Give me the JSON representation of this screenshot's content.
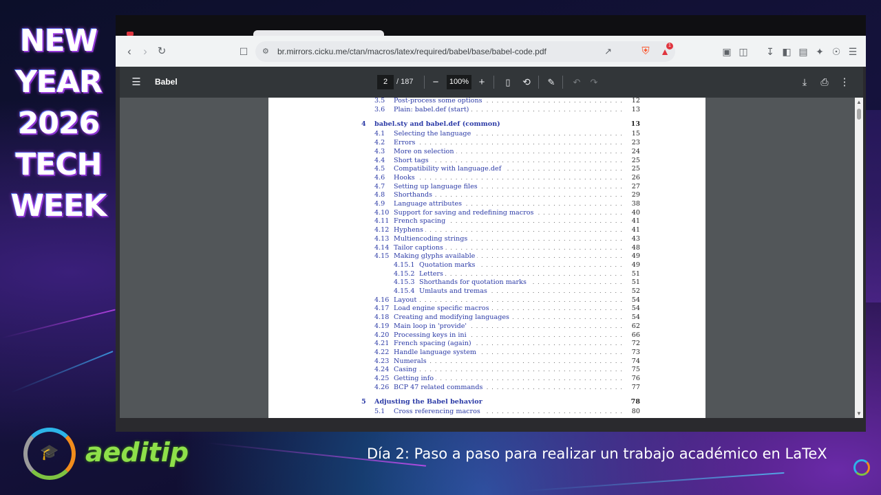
{
  "overlay": {
    "promo_lines": [
      "NEW",
      "YEAR",
      "2026",
      "TECH",
      "WEEK"
    ],
    "brand_name": "aeditip",
    "subtitle": "Día 2: Paso a paso para realizar un trabajo académico en LaTeX"
  },
  "browser": {
    "url": "br.mirrors.cicku.me/ctan/macros/latex/required/babel/base/babel-code.pdf",
    "extension_badge": "1"
  },
  "pdf": {
    "title": "Babel",
    "current_page": "2",
    "total_pages": "/ 187",
    "zoom": "100%"
  },
  "toc": [
    {
      "num": "3.5",
      "title": "Post-process some options",
      "page": "12",
      "level": 1
    },
    {
      "num": "3.6",
      "title": "Plain: babel.def (start)",
      "page": "13",
      "level": 1
    },
    {
      "num": "4",
      "title": "babel.sty and babel.def (common)",
      "page": "13",
      "level": 0
    },
    {
      "num": "4.1",
      "title": "Selecting the language",
      "page": "15",
      "level": 1
    },
    {
      "num": "4.2",
      "title": "Errors",
      "page": "23",
      "level": 1
    },
    {
      "num": "4.3",
      "title": "More on selection",
      "page": "24",
      "level": 1
    },
    {
      "num": "4.4",
      "title": "Short tags",
      "page": "25",
      "level": 1
    },
    {
      "num": "4.5",
      "title": "Compatibility with language.def",
      "page": "25",
      "level": 1
    },
    {
      "num": "4.6",
      "title": "Hooks",
      "page": "26",
      "level": 1
    },
    {
      "num": "4.7",
      "title": "Setting up language files",
      "page": "27",
      "level": 1
    },
    {
      "num": "4.8",
      "title": "Shorthands",
      "page": "29",
      "level": 1
    },
    {
      "num": "4.9",
      "title": "Language attributes",
      "page": "38",
      "level": 1
    },
    {
      "num": "4.10",
      "title": "Support for saving and redefining macros",
      "page": "40",
      "level": 1
    },
    {
      "num": "4.11",
      "title": "French spacing",
      "page": "41",
      "level": 1
    },
    {
      "num": "4.12",
      "title": "Hyphens",
      "page": "41",
      "level": 1
    },
    {
      "num": "4.13",
      "title": "Multiencoding strings",
      "page": "43",
      "level": 1
    },
    {
      "num": "4.14",
      "title": "Tailor captions",
      "page": "48",
      "level": 1
    },
    {
      "num": "4.15",
      "title": "Making glyphs available",
      "page": "49",
      "level": 1
    },
    {
      "num": "4.15.1",
      "title": "Quotation marks",
      "page": "49",
      "level": 2
    },
    {
      "num": "4.15.2",
      "title": "Letters",
      "page": "51",
      "level": 2
    },
    {
      "num": "4.15.3",
      "title": "Shorthands for quotation marks",
      "page": "51",
      "level": 2
    },
    {
      "num": "4.15.4",
      "title": "Umlauts and tremas",
      "page": "52",
      "level": 2
    },
    {
      "num": "4.16",
      "title": "Layout",
      "page": "54",
      "level": 1
    },
    {
      "num": "4.17",
      "title": "Load engine specific macros",
      "page": "54",
      "level": 1
    },
    {
      "num": "4.18",
      "title": "Creating and modifying languages",
      "page": "54",
      "level": 1
    },
    {
      "num": "4.19",
      "title": "Main loop in 'provide'",
      "page": "62",
      "level": 1
    },
    {
      "num": "4.20",
      "title": "Processing keys in ini",
      "page": "66",
      "level": 1
    },
    {
      "num": "4.21",
      "title": "French spacing (again)",
      "page": "72",
      "level": 1
    },
    {
      "num": "4.22",
      "title": "Handle language system",
      "page": "73",
      "level": 1
    },
    {
      "num": "4.23",
      "title": "Numerals",
      "page": "74",
      "level": 1
    },
    {
      "num": "4.24",
      "title": "Casing",
      "page": "75",
      "level": 1
    },
    {
      "num": "4.25",
      "title": "Getting info",
      "page": "76",
      "level": 1
    },
    {
      "num": "4.26",
      "title": "BCP 47 related commands",
      "page": "77",
      "level": 1
    },
    {
      "num": "5",
      "title": "Adjusting the Babel behavior",
      "page": "78",
      "level": 0
    },
    {
      "num": "5.1",
      "title": "Cross referencing macros",
      "page": "80",
      "level": 1
    }
  ]
}
